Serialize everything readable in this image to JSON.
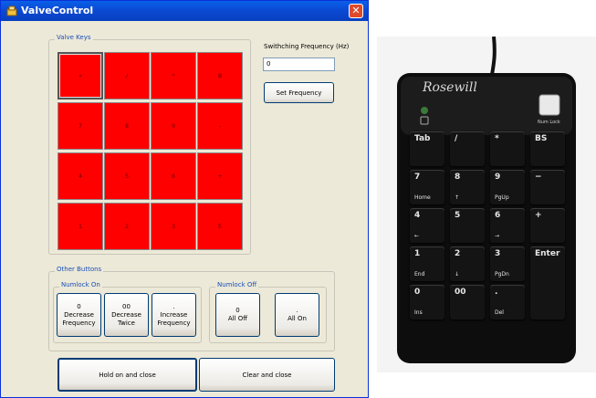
{
  "window": {
    "title": "ValveControl",
    "close_glyph": "✕",
    "icon": "app-icon"
  },
  "valve_keys": {
    "label": "Valve Keys",
    "rows": [
      [
        "*",
        "/",
        "*",
        "B"
      ],
      [
        "7",
        "8",
        "9",
        "-"
      ],
      [
        "4",
        "5",
        "6",
        "+"
      ],
      [
        "1",
        "2",
        "3",
        "E"
      ]
    ]
  },
  "frequency": {
    "label": "Swithching Frequency (Hz)",
    "value": "0",
    "set_button": "Set Frequency"
  },
  "other_buttons": {
    "label": "Other Buttons",
    "numlock_on": {
      "label": "Numlock On",
      "buttons": [
        {
          "line1": "0",
          "line2": "Decrease",
          "line3": "Frequency"
        },
        {
          "line1": "00",
          "line2": "Decrease",
          "line3": "Twice"
        },
        {
          "line1": ".",
          "line2": "Increase",
          "line3": "Frequency"
        }
      ]
    },
    "numlock_off": {
      "label": "Numlock Off",
      "buttons": [
        {
          "line1": "0",
          "line2": "All Off"
        },
        {
          "line1": ".",
          "line2": "All On"
        }
      ]
    }
  },
  "bottom_buttons": {
    "hold": "Hold on and close",
    "clear": "Clear and close"
  },
  "keypad_photo": {
    "brand": "Rosewill",
    "numlock_label": "Num Lock",
    "keys": [
      {
        "main": "Tab",
        "sub": ""
      },
      {
        "main": "/",
        "sub": ""
      },
      {
        "main": "*",
        "sub": ""
      },
      {
        "main": "BS",
        "sub": ""
      },
      {
        "main": "7",
        "sub": "Home"
      },
      {
        "main": "8",
        "sub": "↑"
      },
      {
        "main": "9",
        "sub": "PgUp"
      },
      {
        "main": "−",
        "sub": ""
      },
      {
        "main": "4",
        "sub": "←"
      },
      {
        "main": "5",
        "sub": ""
      },
      {
        "main": "6",
        "sub": "→"
      },
      {
        "main": "+",
        "sub": ""
      },
      {
        "main": "1",
        "sub": "End"
      },
      {
        "main": "2",
        "sub": "↓"
      },
      {
        "main": "3",
        "sub": "PgDn"
      },
      {
        "main": "Enter",
        "sub": ""
      },
      {
        "main": "0",
        "sub": "Ins"
      },
      {
        "main": "00",
        "sub": ""
      },
      {
        "main": ".",
        "sub": "Del"
      }
    ]
  }
}
